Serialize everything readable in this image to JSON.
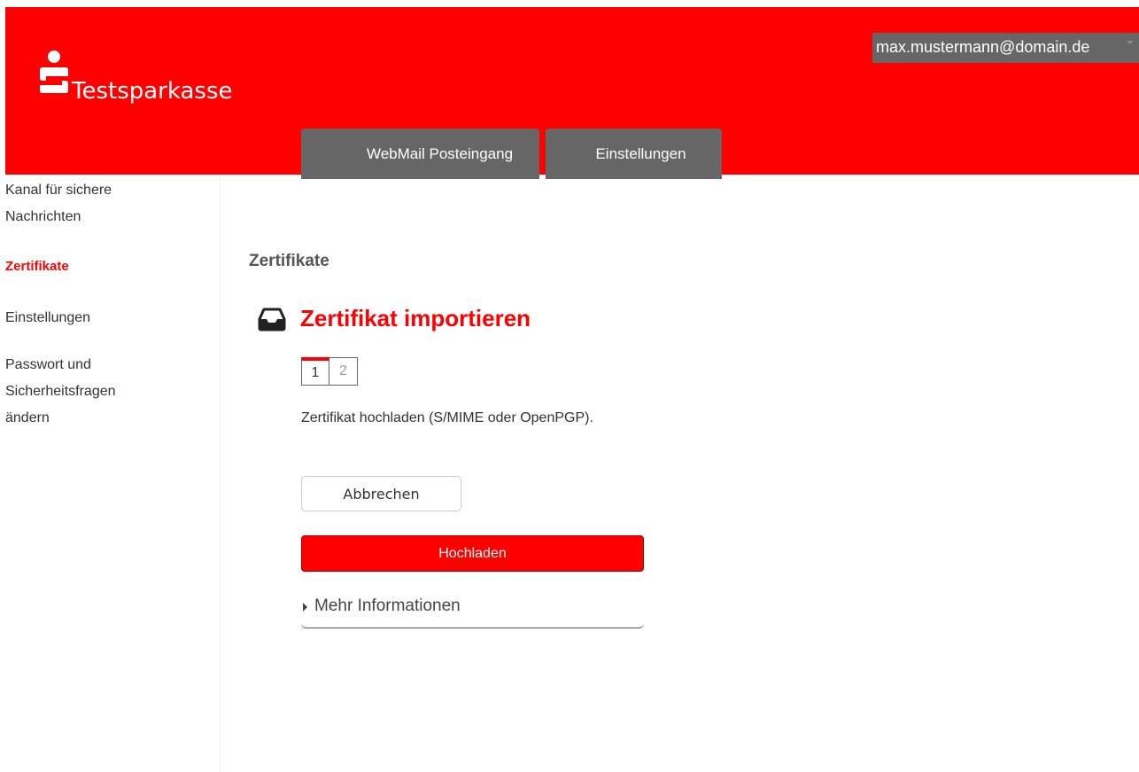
{
  "header": {
    "brand_name": "Testsparkasse",
    "account_email": "max.mustermann@domain.de",
    "tabs": [
      {
        "label": "WebMail Posteingang"
      },
      {
        "label": "Einstellungen"
      }
    ],
    "colors": {
      "brand_red": "#ff0000",
      "tab_gray": "#666666"
    }
  },
  "sidebar": {
    "items": [
      {
        "label": "Kanal für sichere Nachrichten",
        "lines": [
          "Kanal für sichere",
          "Nachrichten"
        ]
      },
      {
        "label": "Zertifikate",
        "active": true
      },
      {
        "label": "Einstellungen"
      },
      {
        "label": "Passwort und Sicherheitsfragen ändern",
        "lines": [
          "Passwort und",
          "Sicherheitsfragen",
          "ändern"
        ]
      }
    ]
  },
  "main": {
    "page_title": "Zertifikate",
    "section_icon": "tray-icon",
    "section_title": "Zertifikat importieren",
    "steps": {
      "current": "1",
      "next": "2"
    },
    "description": "Zertifikat hochladen (S/MIME oder OpenPGP).",
    "cancel_label": "Abbrechen",
    "upload_label": "Hochladen",
    "more_info_label": "Mehr Informationen"
  }
}
